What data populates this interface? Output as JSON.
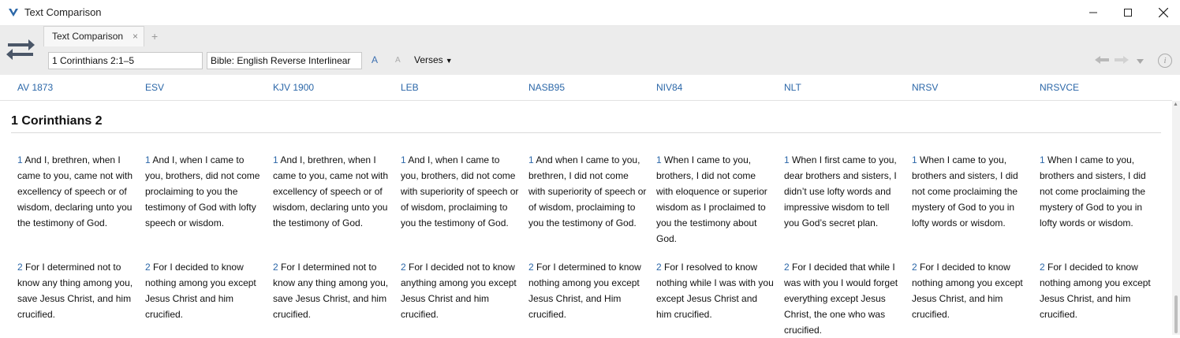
{
  "window": {
    "title": "Text Comparison"
  },
  "tabs": [
    {
      "label": "Text Comparison",
      "close": "×"
    }
  ],
  "tab_add": "+",
  "toolbar": {
    "reference": "1 Corinthians 2:1–5",
    "bible": "Bible: English Reverse Interlinear",
    "font_larger": "A",
    "font_smaller": "A",
    "verses_label": "Verses",
    "verses_caret": "▼",
    "info": "i"
  },
  "columns": [
    {
      "name": "AV 1873",
      "v1": "And I, brethren, when I came to you, came not with excellency of speech or of wisdom, declaring unto you the testimony of God.",
      "v2": "For I determined not to know any thing among you, save Jesus Christ, and him crucified."
    },
    {
      "name": "ESV",
      "v1": "And I, when I came to you, brothers, did not come proclaiming to you the testimony of God with lofty speech or wisdom.",
      "v2": "For I decided to know nothing among you except Jesus Christ and him crucified."
    },
    {
      "name": "KJV 1900",
      "v1": "And I, brethren, when I came to you, came not with excellency of speech or of wisdom, declaring unto you the testimony of God.",
      "v2": "For I determined not to know any thing among you, save Jesus Christ, and him crucified."
    },
    {
      "name": "LEB",
      "v1": "And I, when I came to you, brothers, did not come with superiority of speech or of wisdom, proclaiming to you the testimony of God.",
      "v2": "For I decided not to know anything among you except Jesus Christ and him crucified."
    },
    {
      "name": "NASB95",
      "v1": "And when I came to you, brethren, I did not come with superiority of speech or of wisdom, proclaiming to you the testimony of God.",
      "v2": "For I determined to know nothing among you except Jesus Christ, and Him crucified."
    },
    {
      "name": "NIV84",
      "v1": "When I came to you, brothers, I did not come with eloquence or superior wisdom as I proclaimed to you the testimony about God.",
      "v2": "For I resolved to know nothing while I was with you except Jesus Christ and him crucified."
    },
    {
      "name": "NLT",
      "v1": "When I first came to you, dear brothers and sisters, I didn’t use lofty words and impressive wisdom to tell you God’s secret plan.",
      "v2": "For I decided that while I was with you I would forget everything except Jesus Christ, the one who was crucified."
    },
    {
      "name": "NRSV",
      "v1": "When I came to you, brothers and sisters, I did not come proclaiming the mystery of God to you in lofty words or wisdom.",
      "v2": "For I decided to know nothing among you except Jesus Christ, and him crucified."
    },
    {
      "name": "NRSVCE",
      "v1": "When I came to you, brothers and sisters, I did not come proclaiming the mystery of God to you in lofty words or wisdom.",
      "v2": "For I decided to know nothing among you except Jesus Christ, and him crucified."
    }
  ],
  "chapter": "1 Corinthians 2",
  "verse_numbers": {
    "v1": "1",
    "v2": "2"
  },
  "colors": {
    "accent": "#2b67a8",
    "toolbar_bg": "#ececec"
  }
}
